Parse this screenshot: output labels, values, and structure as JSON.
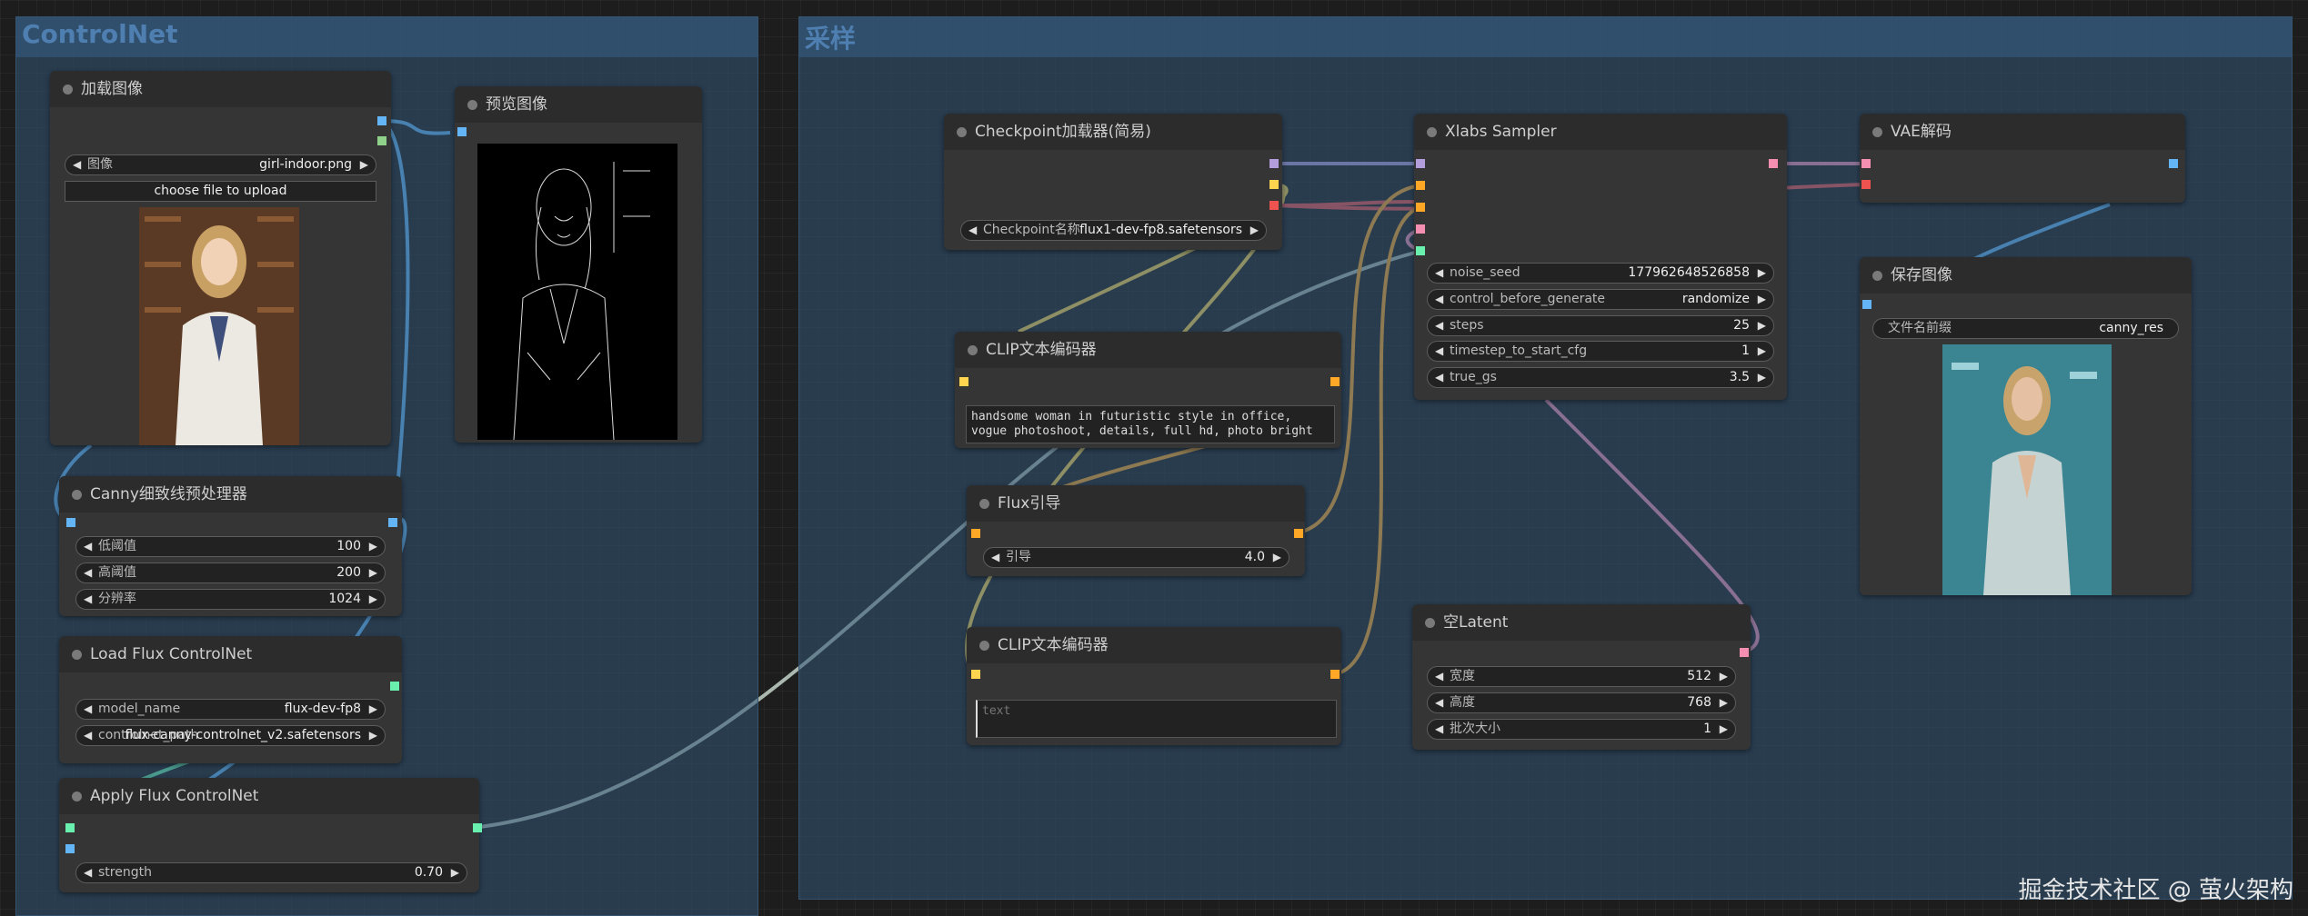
{
  "groups": {
    "controlnet": {
      "title": "ControlNet"
    },
    "sampling": {
      "title": "采样"
    }
  },
  "nodes": {
    "load_image": {
      "title": "加载图像",
      "image_label": "图像",
      "image_value": "girl-indoor.png",
      "upload_label": "choose file to upload"
    },
    "preview_image": {
      "title": "预览图像"
    },
    "canny": {
      "title": "Canny细致线预处理器",
      "low_label": "低阈值",
      "low_value": "100",
      "high_label": "高阈值",
      "high_value": "200",
      "res_label": "分辨率",
      "res_value": "1024"
    },
    "load_flux_controlnet": {
      "title": "Load Flux ControlNet",
      "model_label": "model_name",
      "model_value": "flux-dev-fp8",
      "controlnet_label": "controlnet_path",
      "controlnet_value": "flux-canny-controlnet_v2.safetensors"
    },
    "apply_flux_controlnet": {
      "title": "Apply Flux ControlNet",
      "strength_label": "strength",
      "strength_value": "0.70"
    },
    "checkpoint": {
      "title": "Checkpoint加载器(简易)",
      "ckpt_label": "Checkpoint名称",
      "ckpt_value": "flux1-dev-fp8.safetensors"
    },
    "clip_pos": {
      "title": "CLIP文本编码器",
      "text": "handsome woman in futuristic style in office, vogue photoshoot, details, full hd, photo bright"
    },
    "flux_guidance": {
      "title": "Flux引导",
      "guidance_label": "引导",
      "guidance_value": "4.0"
    },
    "clip_neg": {
      "title": "CLIP文本编码器",
      "placeholder": "text"
    },
    "xlabs_sampler": {
      "title": "Xlabs Sampler",
      "noise_seed_label": "noise_seed",
      "noise_seed_value": "177962648526858",
      "control_label": "control_before_generate",
      "control_value": "randomize",
      "steps_label": "steps",
      "steps_value": "25",
      "timestep_label": "timestep_to_start_cfg",
      "timestep_value": "1",
      "truegs_label": "true_gs",
      "truegs_value": "3.5"
    },
    "vae_decode": {
      "title": "VAE解码"
    },
    "save_image": {
      "title": "保存图像",
      "prefix_label": "文件名前缀",
      "prefix_value": "canny_res"
    },
    "empty_latent": {
      "title": "空Latent",
      "width_label": "宽度",
      "width_value": "512",
      "height_label": "高度",
      "height_value": "768",
      "batch_label": "批次大小",
      "batch_value": "1"
    }
  },
  "watermark": "掘金技术社区 @ 萤火架构",
  "colors": {
    "model": "#b39ddb",
    "clip": "#ffd54f",
    "vae": "#ef5350",
    "conditioning": "#ffa726",
    "image": "#64b5f6",
    "latent": "#f48fb1",
    "controlnet": "#69f0ae",
    "controlnet_cond": "#90a4ae"
  }
}
